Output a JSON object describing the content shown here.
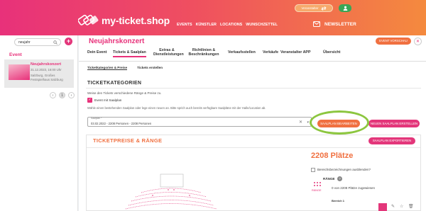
{
  "header": {
    "logo_text": "my-ticket.shop",
    "nav": [
      "EVENTS",
      "KÜNSTLER",
      "LOCATIONS",
      "WUNSCHZETTEL"
    ],
    "lang_label": "Veranstalter",
    "lang_icon": "swap-icon",
    "user_icon": "user-icon",
    "newsletter_label": "NEWSLETTER",
    "newsletter_icon": "mail-icon",
    "colors": {
      "gradient_start": "#e8317a",
      "gradient_end": "#f48a3e"
    }
  },
  "sidebar": {
    "search_value": "neujahr",
    "search_icon": "search-icon",
    "add_label": "+",
    "section_label": "Event",
    "event": {
      "title": "Neujahrskonzert",
      "datetime": "31.12.2023, 16:00 Uhr",
      "place": "Salzburg, Großes",
      "venue": "Festspielhaus Salzburg"
    },
    "pager_prev": "‹",
    "pager_page": "1",
    "pager_next": "›"
  },
  "main": {
    "title": "Neujahrskonzert",
    "preview_button": "EVENT VORSCHAU",
    "close_label": "✕",
    "tabs": [
      {
        "label": "Dein Event"
      },
      {
        "label": "Tickets & Saalplan"
      },
      {
        "label": "Extras & Dienstleistungen"
      },
      {
        "label": "Richtlinien & Beschränkungen"
      },
      {
        "label": "Verkaufsstellen"
      },
      {
        "label": "Verkäufe"
      },
      {
        "label": "Veranstalter APP"
      },
      {
        "label": "Übersicht"
      }
    ],
    "active_tab": "Tickets & Saalplan",
    "subtabs": [
      "Ticketkategorien & Preise",
      "Tickets erstellen"
    ],
    "section_title": "TICKETKATEGORIEN",
    "intro_text": "Weise den Tickets verschiedene Ränge & Preise zu.",
    "checkbox_label": "Event mit Saalplan",
    "checkbox_checked": true,
    "help_text": "Wähle einen bestehenden Saalplan oder lege einen neuen an. Bitte sprich auch bereits verfügbare Saalpläne mit der Halle/Location ab.",
    "select": {
      "label": "Saalplan *",
      "value": "03.02.2022 - 2208 Personen - 2208 Personen",
      "clear_icon": "clear-icon",
      "caret_icon": "chevron-down-icon"
    },
    "edit_button": "SAALPLAN BEARBEITEN",
    "new_button": "NEUEN SAALPLAN ERSTELLEN"
  },
  "panel": {
    "title": "TICKETPREISE & RÄNGE",
    "export_button": "SAALPLAN EXPORTIEREN",
    "seat_count": "2208 Plätze",
    "hide_label": "Bereichsbezeichnungen ausblenden?",
    "ranks_heading": "RÄNGE",
    "ranks_help": "?",
    "rank_icon_label": "RÄNGE",
    "assigned_text": "0 von 2208 Plätze zugewiesen",
    "area_label": "Bereich 1",
    "rank_color": "#e3367a",
    "actions": [
      "edit-icon",
      "star-icon",
      "trash-icon"
    ]
  }
}
